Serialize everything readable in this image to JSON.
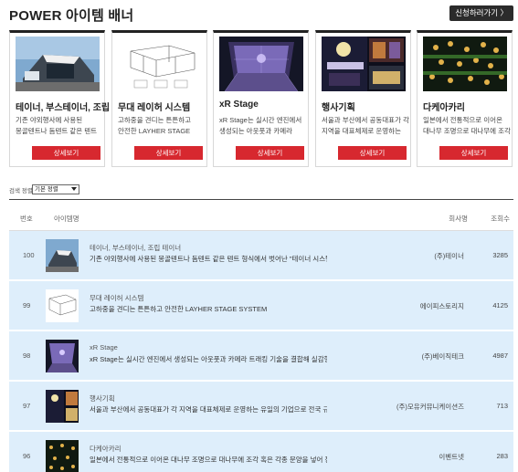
{
  "header": {
    "title": "POWER 아이템 배너",
    "apply_label": "신청하러가기 〉"
  },
  "cards": [
    {
      "title": "테이너, 부스테이너, 조립",
      "desc": [
        "기존 야외행사에 사용된",
        "몽골텐트나 돔텐트 같은 텐트"
      ],
      "button": "상세보기",
      "image": "tent-building-image"
    },
    {
      "title": "무대 레이허 시스템",
      "desc": [
        "고하중을 견디는 튼튼하고",
        "안전한 LAYHER STAGE"
      ],
      "button": "상세보기",
      "image": "stage-scaffold-image"
    },
    {
      "title": "xR Stage",
      "desc": [
        "xR Stage는 실시간 엔진에서",
        "생성되는 아웃풋과 카메라"
      ],
      "button": "상세보기",
      "image": "xr-stage-image"
    },
    {
      "title": "행사기획",
      "desc": [
        "서울과 부산에서 공동대표가 각",
        "지역을 대표체제로 운영하는"
      ],
      "button": "상세보기",
      "image": "event-planning-image"
    },
    {
      "title": "다케아카리",
      "desc": [
        "일본에서 전통적으로 이어온",
        "대나무 조명으로 대나무에 조각"
      ],
      "button": "상세보기",
      "image": "bamboo-light-image"
    }
  ],
  "sort": {
    "label": "검색 정렬",
    "selected": "기본 정렬"
  },
  "table": {
    "headers": {
      "num": "번호",
      "image": "아이템명",
      "company": "회사명",
      "views": "조회수"
    },
    "rows": [
      {
        "num": "100",
        "title": "테이너, 부스테이너, 조립 테이너",
        "desc": "기존 야외행사에 사용된 몽골텐트나 돔텐트 같은 텐트 형식에서 벗어난 \"테이너 시스템 부스(T...",
        "company": "(주)테이너",
        "views": "3285",
        "image": "tent-building-image"
      },
      {
        "num": "99",
        "title": "무대 레이허 시스템",
        "desc": "고하중을 견디는 튼튼하고 안전한 LAYHER STAGE SYSTEM",
        "company": "에이피스토리지",
        "views": "4125",
        "image": "stage-scaffold-image"
      },
      {
        "num": "98",
        "title": "xR Stage",
        "desc": "xR Stage는 실시간 엔진에서 생성되는 아웃풋과 카메라 트래킹 기술을 결합해 실감형 가상 환...",
        "company": "(주)베이직테크",
        "views": "4987",
        "image": "xr-stage-image"
      },
      {
        "num": "97",
        "title": "행사기획",
        "desc": "서울과 부산에서 공동대표가 각 지역을 대표체제로 운영하는 유일의 기업으로 전국 규모의 프...",
        "company": "(주)모유커뮤니케이션즈",
        "views": "713",
        "image": "event-planning-image"
      },
      {
        "num": "96",
        "title": "다케아카리",
        "desc": "일본에서 전통적으로 이어온 대나무 조명으로 대나무에 조각 혹은 각종 문양을 넣어 장식으로 ...",
        "company": "이벤트넷",
        "views": "283",
        "image": "bamboo-light-image"
      }
    ]
  }
}
